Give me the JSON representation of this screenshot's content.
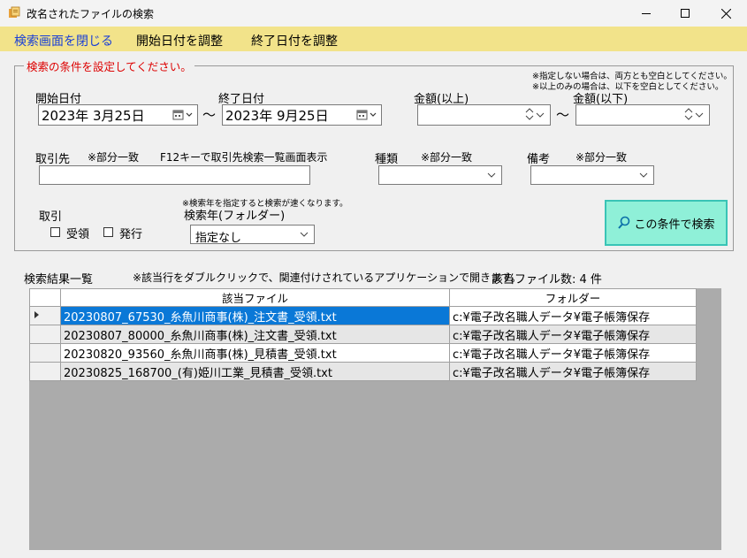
{
  "window": {
    "title": "改名されたファイルの検索",
    "minimize_icon": "minimize-icon",
    "maximize_icon": "maximize-icon",
    "close_icon": "close-icon"
  },
  "menu": {
    "close_search": "検索画面を閉じる",
    "adjust_start": "開始日付を調整",
    "adjust_end": "終了日付を調整"
  },
  "criteria": {
    "legend": "検索の条件を設定してください。",
    "note1": "※指定しない場合は、両方とも空白としてください。",
    "note2": "※以上のみの場合は、以下を空白としてください。",
    "start_label": "開始日付",
    "start_value": "2023年  3月25日",
    "tilde": "～",
    "end_label": "終了日付",
    "end_value": "2023年  9月25日",
    "amount_min_label": "金額(以上)",
    "amount_min_value": "",
    "amount_max_label": "金額(以下)",
    "amount_max_value": "",
    "partner_label": "取引先",
    "partner_note": "※部分一致",
    "partner_hint": "F12キーで取引先検索一覧画面表示",
    "partner_value": "",
    "kind_label": "種類",
    "kind_note": "※部分一致",
    "kind_value": "",
    "remark_label": "備考",
    "remark_note": "※部分一致",
    "remark_value": "",
    "trade_label": "取引",
    "receive_label": "受領",
    "issue_label": "発行",
    "receive_checked": false,
    "issue_checked": false,
    "year_note": "※検索年を指定すると検索が速くなります。",
    "year_label": "検索年(フォルダー)",
    "year_value": "指定なし",
    "search_button": "この条件で検索"
  },
  "results": {
    "title": "検索結果一覧",
    "note": "※該当行をダブルクリックで、関連付けされているアプリケーションで開きます。",
    "count": "該当ファイル数: 4 件",
    "columns": [
      "該当ファイル",
      "フォルダー"
    ],
    "rows": [
      {
        "file": "20230807_67530_糸魚川商事(株)_注文書_受領.txt",
        "folder": "c:¥電子改名職人データ¥電子帳簿保存"
      },
      {
        "file": "20230807_80000_糸魚川商事(株)_注文書_受領.txt",
        "folder": "c:¥電子改名職人データ¥電子帳簿保存"
      },
      {
        "file": "20230820_93560_糸魚川商事(株)_見積書_受領.txt",
        "folder": "c:¥電子改名職人データ¥電子帳簿保存"
      },
      {
        "file": "20230825_168700_(有)姫川工業_見積書_受領.txt",
        "folder": "c:¥電子改名職人データ¥電子帳簿保存"
      }
    ]
  },
  "colors": {
    "menubar": "#f2e38a",
    "menu_text": "#1a3fd6",
    "legend_text": "#d00000",
    "search_button": "#8ff0d8",
    "selection": "#0a78d7"
  }
}
